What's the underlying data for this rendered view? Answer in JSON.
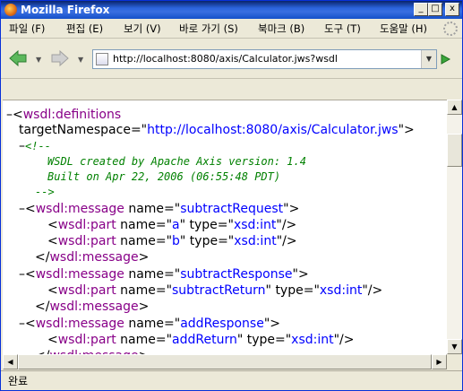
{
  "window": {
    "title": "Mozilla Firefox",
    "min_glyph": "_",
    "max_glyph": "□",
    "close_glyph": "x"
  },
  "menu": [
    "파일 (F)",
    "편집 (E)",
    "보기 (V)",
    "바로 가기 (S)",
    "북마크 (B)",
    "도구 (T)",
    "도움말 (H)"
  ],
  "toolbar": {
    "back_icon": "back-arrow-icon",
    "forward_icon": "forward-arrow-icon",
    "url": "http://localhost:8080/axis/Calculator.jws?wsdl",
    "go_icon": "go-arrow-icon"
  },
  "xml": {
    "definitions_tag": "wsdl:definitions",
    "target_ns_attr": "targetNamespace",
    "target_ns_val": "http://localhost:8080/axis/Calculator.jws",
    "comment_open": "<!--",
    "comment_line1": "WSDL created by Apache Axis version: 1.4",
    "comment_line2": "Built on Apr 22, 2006 (06:55:48 PDT)",
    "comment_close": "-->",
    "message_tag": "wsdl:message",
    "part_tag": "wsdl:part",
    "name_attr": "name",
    "type_attr": "type",
    "msg1_name": "subtractRequest",
    "msg1_part1_name": "a",
    "msg1_part1_type": "xsd:int",
    "msg1_part2_name": "b",
    "msg1_part2_type": "xsd:int",
    "msg2_name": "subtractResponse",
    "msg2_part1_name": "subtractReturn",
    "msg2_part1_type": "xsd:int",
    "msg3_name": "addResponse",
    "msg3_part1_name": "addReturn",
    "msg3_part1_type": "xsd:int",
    "toggle": "–"
  },
  "status": {
    "text": "완료"
  },
  "colors": {
    "tag": "#880088",
    "value": "#0000ff",
    "comment": "#008000"
  }
}
